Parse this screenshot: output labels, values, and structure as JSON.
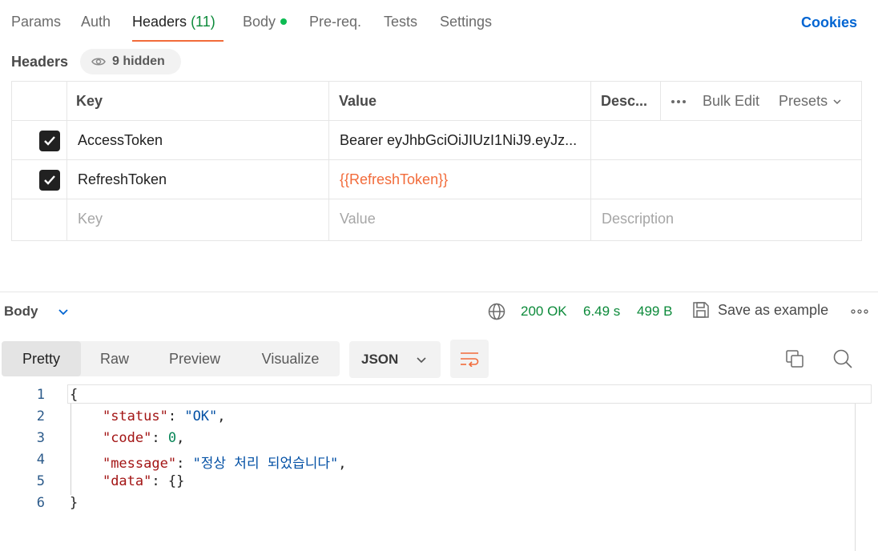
{
  "tabs": {
    "params": "Params",
    "auth": "Auth",
    "headers": "Headers",
    "headers_count": "(11)",
    "body": "Body",
    "prereq": "Pre-req.",
    "tests": "Tests",
    "settings": "Settings",
    "cookies": "Cookies"
  },
  "headers_section": {
    "label": "Headers",
    "hidden": "9 hidden"
  },
  "table": {
    "columns": {
      "key": "Key",
      "value": "Value",
      "desc": "Desc..."
    },
    "bulk_edit": "Bulk Edit",
    "presets": "Presets",
    "rows": [
      {
        "key": "AccessToken",
        "value": "Bearer eyJhbGciOiJIUzI1NiJ9.eyJz...",
        "checked": true
      },
      {
        "key": "RefreshToken",
        "value": "{{RefreshToken}}",
        "checked": true
      }
    ],
    "placeholder": {
      "key": "Key",
      "value": "Value",
      "desc": "Description"
    }
  },
  "response": {
    "body_label": "Body",
    "status": "200 OK",
    "time": "6.49 s",
    "size": "499 B",
    "save_example": "Save as example",
    "view_tabs": [
      "Pretty",
      "Raw",
      "Preview",
      "Visualize"
    ],
    "format": "JSON"
  },
  "code": {
    "line_numbers": [
      "1",
      "2",
      "3",
      "4",
      "5",
      "6"
    ],
    "brace_open": "{",
    "status_key": "\"status\"",
    "status_val": "\"OK\"",
    "code_key": "\"code\"",
    "code_val": "0",
    "message_key": "\"message\"",
    "message_val": "\"정상 처리 되었습니다\"",
    "data_key": "\"data\"",
    "data_val": "{}",
    "brace_close": "}"
  },
  "colors": {
    "accent": "#f26b3a",
    "link": "#0265d2",
    "success": "#0c8a3a"
  }
}
